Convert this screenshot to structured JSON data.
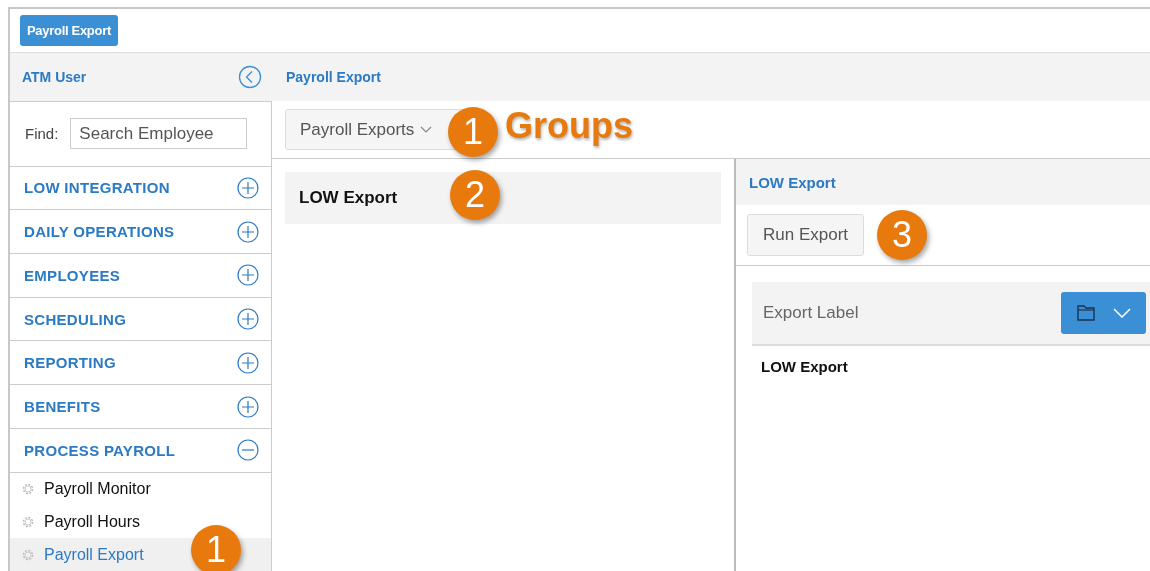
{
  "top_bar": {
    "button": "Payroll Export"
  },
  "sidebar": {
    "user": "ATM User",
    "find_label": "Find:",
    "search": {
      "placeholder": "Search Employee"
    },
    "sections": [
      {
        "label": "LOW INTEGRATION",
        "expanded": false
      },
      {
        "label": "DAILY OPERATIONS",
        "expanded": false
      },
      {
        "label": "EMPLOYEES",
        "expanded": false
      },
      {
        "label": "SCHEDULING",
        "expanded": false
      },
      {
        "label": "REPORTING",
        "expanded": false
      },
      {
        "label": "BENEFITS",
        "expanded": false
      },
      {
        "label": "PROCESS PAYROLL",
        "expanded": true,
        "children": [
          {
            "label": "Payroll Monitor",
            "selected": false
          },
          {
            "label": "Payroll Hours",
            "selected": false
          },
          {
            "label": "Payroll Export",
            "selected": true
          }
        ]
      }
    ]
  },
  "breadcrumb": "Payroll Export",
  "group_dropdown": {
    "value": "Payroll Exports"
  },
  "export_list": [
    {
      "label": "LOW Export",
      "selected": true
    }
  ],
  "detail": {
    "title": "LOW Export",
    "run_button": "Run Export",
    "table": {
      "columns": [
        "Export Label"
      ],
      "rows": [
        [
          "LOW Export"
        ]
      ]
    }
  },
  "callouts": [
    {
      "number": "1",
      "caption": "Groups"
    },
    {
      "number": "2"
    },
    {
      "number": "3"
    },
    {
      "number": "1"
    }
  ]
}
